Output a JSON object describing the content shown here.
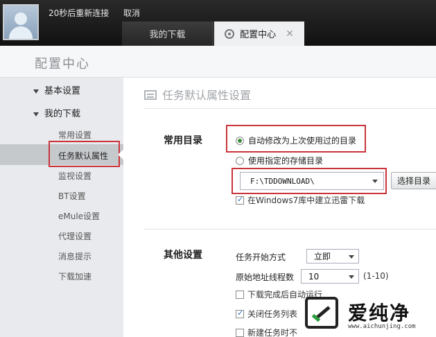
{
  "top_bar": {
    "reconnect_text": "20秒后重新连接",
    "cancel_label": "取消",
    "tabs": [
      {
        "label": "我的下载",
        "active": false
      },
      {
        "label": "配置中心",
        "active": true,
        "close": "✕"
      }
    ]
  },
  "page_title": "配置中心",
  "sidebar": {
    "sections": [
      {
        "label": "基本设置",
        "expanded": true
      },
      {
        "label": "我的下载",
        "expanded": true
      }
    ],
    "items": [
      {
        "label": "常用设置"
      },
      {
        "label": "任务默认属性",
        "selected": true
      },
      {
        "label": "监视设置"
      },
      {
        "label": "BT设置"
      },
      {
        "label": "eMule设置"
      },
      {
        "label": "代理设置"
      },
      {
        "label": "消息提示"
      },
      {
        "label": "下载加速"
      }
    ]
  },
  "main": {
    "section_title": "任务默认属性设置",
    "common_dir": {
      "label": "常用目录",
      "option_auto": "自动修改为上次使用过的目录",
      "option_specified": "使用指定的存储目录",
      "selected_option": "option_auto",
      "path_value": "F:\\TDDOWNLOAD\\",
      "choose_button": "选择目录",
      "win7_library_label": "在Windows7库中建立迅雷下载",
      "win7_library_checked": true
    },
    "other_settings": {
      "label": "其他设置",
      "start_mode_label": "任务开始方式",
      "start_mode_value": "立即",
      "threads_label": "原始地址线程数",
      "threads_value": "10",
      "threads_range": "(1-10)",
      "auto_run_label": "下载完成后自动运行",
      "auto_run_checked": false,
      "close_list_label": "关闭任务列表",
      "close_list_checked": true,
      "new_task_label": "新建任务时不",
      "new_task_checked": false
    }
  },
  "watermark": {
    "text": "爱纯净",
    "url": "www.aichunjing.com"
  },
  "colors": {
    "highlight_red": "#c9333a",
    "top_bar": "#1a1a1a",
    "sidebar_bg": "#e8eaed",
    "sidebar_selected": "#c6c9cc"
  }
}
